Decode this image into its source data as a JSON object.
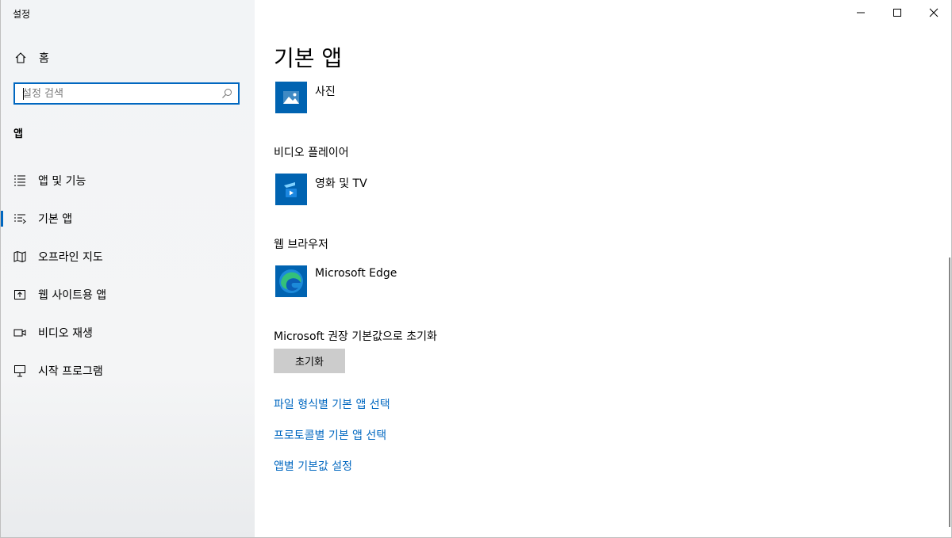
{
  "window": {
    "title": "설정",
    "accent_color": "#0067c0"
  },
  "sidebar": {
    "home_label": "홈",
    "search_placeholder": "설정 검색",
    "section_header": "앱",
    "items": [
      {
        "label": "앱 및 기능",
        "icon": "list-icon",
        "selected": false
      },
      {
        "label": "기본 앱",
        "icon": "default-apps-icon",
        "selected": true
      },
      {
        "label": "오프라인 지도",
        "icon": "map-icon",
        "selected": false
      },
      {
        "label": "웹 사이트용 앱",
        "icon": "open-in-app-icon",
        "selected": false
      },
      {
        "label": "비디오 재생",
        "icon": "video-icon",
        "selected": false
      },
      {
        "label": "시작 프로그램",
        "icon": "startup-icon",
        "selected": false
      }
    ]
  },
  "main": {
    "title": "기본 앱",
    "photo": {
      "app_name": "사진"
    },
    "video_player": {
      "category": "비디오 플레이어",
      "app_name": "영화 및 TV"
    },
    "web_browser": {
      "category": "웹 브라우저",
      "app_name": "Microsoft Edge"
    },
    "reset": {
      "label": "Microsoft 권장 기본값으로 초기화",
      "button_label": "초기화"
    },
    "links": [
      {
        "label": "파일 형식별 기본 앱 선택"
      },
      {
        "label": "프로토콜별 기본 앱 선택"
      },
      {
        "label": "앱별 기본값 설정"
      }
    ]
  }
}
